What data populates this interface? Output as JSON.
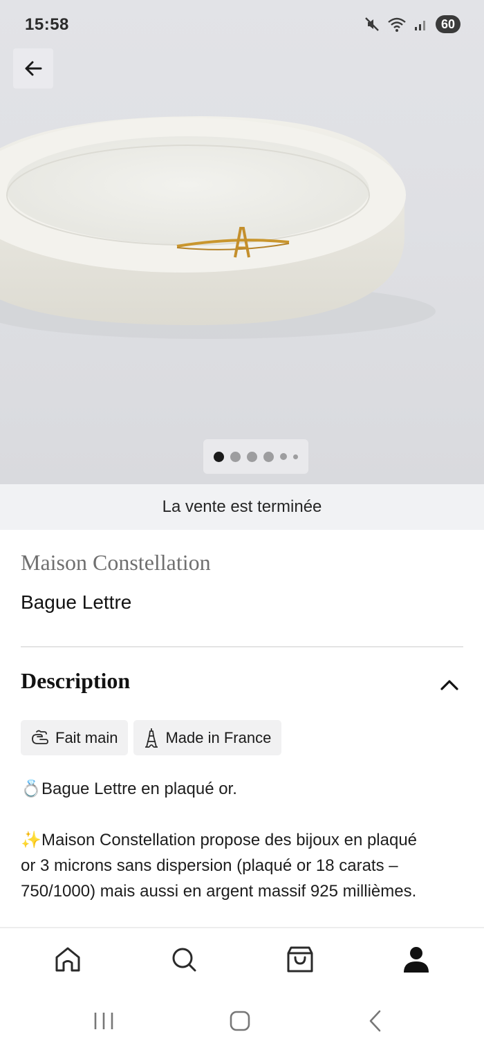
{
  "status_bar": {
    "time": "15:58",
    "battery": "60",
    "icons": [
      "mute-icon",
      "wifi-icon",
      "signal-icon",
      "battery-icon"
    ]
  },
  "gallery": {
    "dot_count": 6,
    "active_index": 0
  },
  "sale_banner": "La vente est terminée",
  "product": {
    "brand": "Maison Constellation",
    "name": "Bague Lettre"
  },
  "description": {
    "title": "Description",
    "chips": [
      {
        "icon": "hands-icon",
        "label": "Fait main"
      },
      {
        "icon": "eiffel-tower-icon",
        "label": "Made in France"
      }
    ],
    "paragraphs": [
      {
        "emoji": "💍",
        "text": "Bague Lettre en plaqué or."
      },
      {
        "emoji": "✨",
        "text": "Maison Constellation propose des bijoux en plaqué or 3 microns sans dispersion (plaqué or 18 carats – 750/1000) mais aussi en argent massif 925 millièmes."
      }
    ]
  },
  "bottom_nav": {
    "items": [
      "home-icon",
      "search-icon",
      "bag-icon",
      "profile-icon"
    ],
    "active": "profile-icon"
  },
  "colors": {
    "banner_bg": "#f1f2f4",
    "chip_bg": "#f1f1f2",
    "text": "#1a1a1a",
    "brand_text": "#6f6f6f"
  }
}
